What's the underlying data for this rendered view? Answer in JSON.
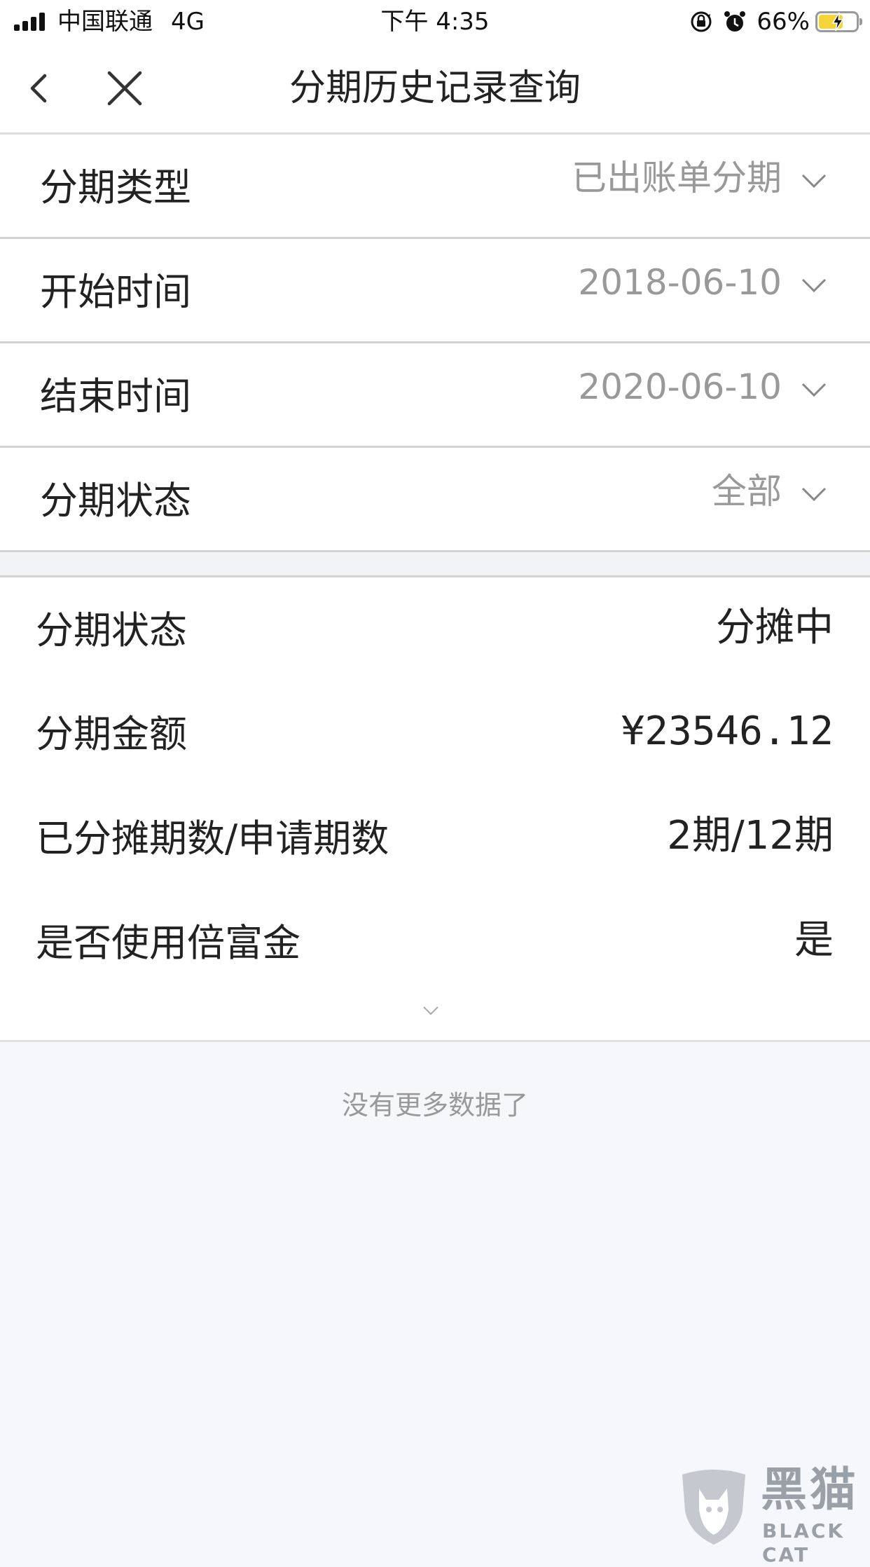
{
  "status_bar": {
    "carrier": "中国联通",
    "network": "4G",
    "time": "下午 4:35",
    "battery": "66%",
    "battery_level": 0.66,
    "icons": [
      "signal-icon",
      "rotation-lock-icon",
      "alarm-icon",
      "battery-icon",
      "charging-bolt-icon"
    ]
  },
  "nav": {
    "title": "分期历史记录查询",
    "icons": [
      "back-icon",
      "close-icon"
    ]
  },
  "filters": [
    {
      "label": "分期类型",
      "value": "已出账单分期"
    },
    {
      "label": "开始时间",
      "value": "2018-06-10"
    },
    {
      "label": "结束时间",
      "value": "2020-06-10"
    },
    {
      "label": "分期状态",
      "value": "全部"
    }
  ],
  "record": {
    "rows": [
      {
        "label": "分期状态",
        "value": "分摊中"
      },
      {
        "label": "分期金额",
        "value": "¥23546.12"
      },
      {
        "label": "已分摊期数/申请期数",
        "value": "2期/12期"
      },
      {
        "label": "是否使用倍富金",
        "value": "是"
      }
    ]
  },
  "footer": {
    "no_more": "没有更多数据了"
  },
  "watermark": {
    "text": "黑猫",
    "subtext": "BLACK CAT"
  },
  "colors": {
    "background": "#f6f7fb",
    "text_primary": "#222222",
    "text_secondary": "#999999",
    "battery": "#f5d33b",
    "divider": "#d2d2d2"
  }
}
